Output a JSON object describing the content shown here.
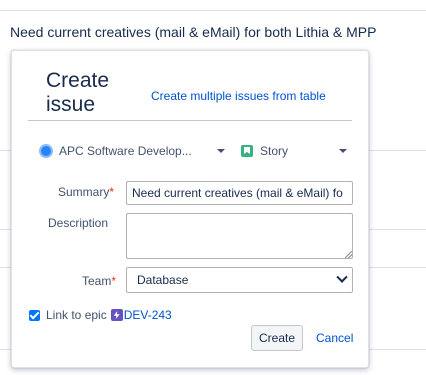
{
  "background": {
    "row_text": "Need current creatives (mail & eMail) for both Lithia & MPP"
  },
  "popup": {
    "title": "Create issue",
    "multi_link": "Create multiple issues from table",
    "project": {
      "label": "APC Software Develop...",
      "icon": "project-avatar-icon"
    },
    "issue_type": {
      "label": "Story",
      "icon": "story-icon"
    },
    "fields": {
      "summary_label": "Summary",
      "summary_value": "Need current creatives (mail & eMail) fo",
      "description_label": "Description",
      "description_value": "",
      "team_label": "Team",
      "team_value": "Database",
      "required_marker": "*"
    },
    "epic": {
      "checked": true,
      "label": "Link to epic",
      "key": "DEV-243",
      "icon": "epic-icon"
    },
    "actions": {
      "create_label": "Create",
      "cancel_label": "Cancel"
    }
  },
  "colors": {
    "link": "#0052cc",
    "required": "#de350b",
    "checkbox": "#0075ff",
    "story": "#36b37e",
    "epic": "#6554c0"
  }
}
